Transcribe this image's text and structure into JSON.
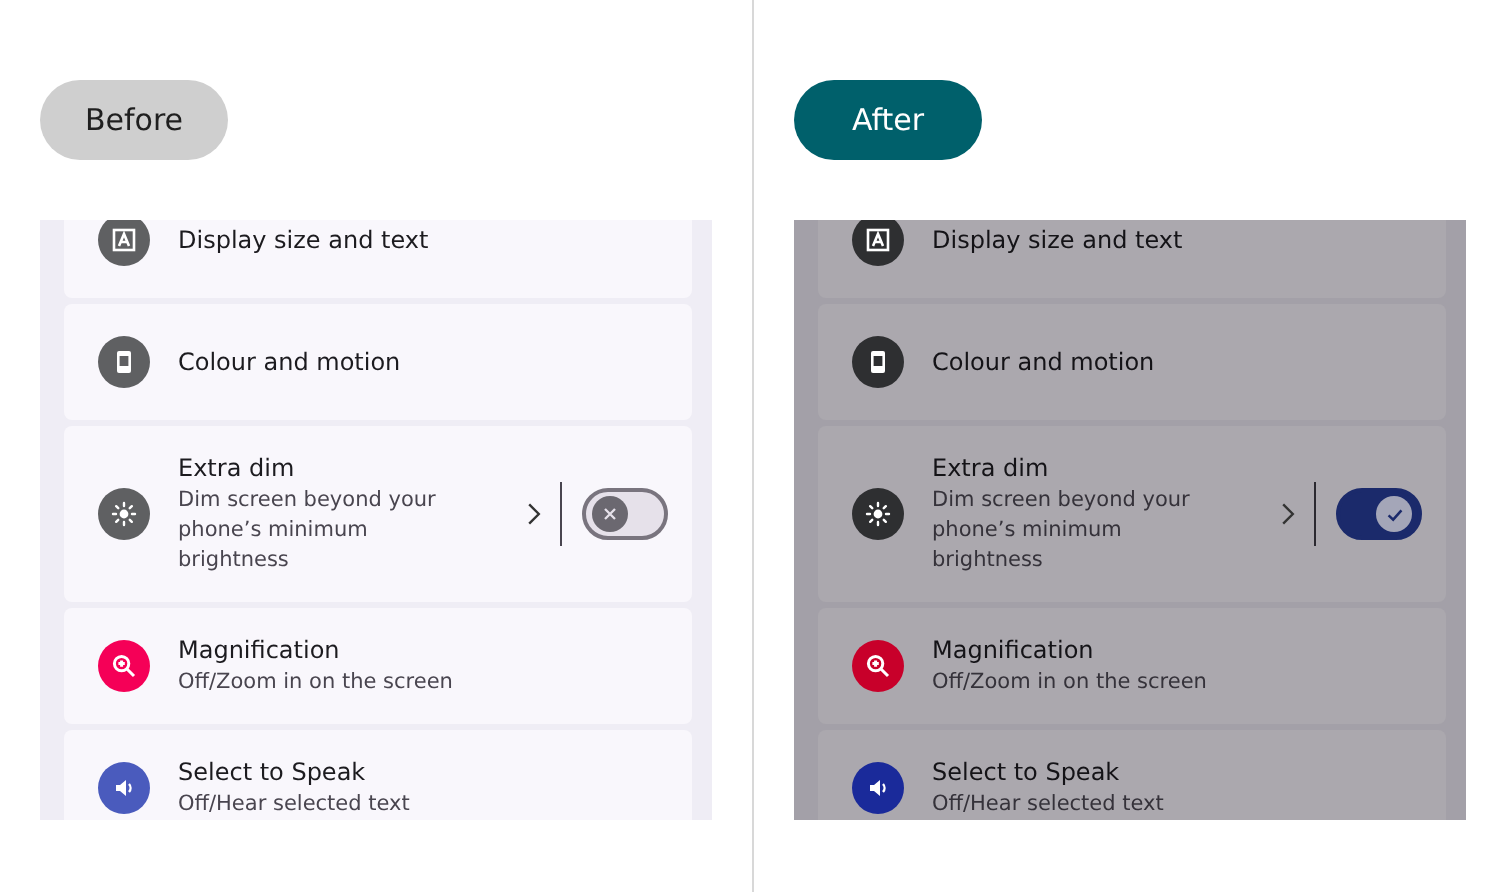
{
  "panels": [
    {
      "label": "Before",
      "color": "#cfcfcf",
      "dimmed": false,
      "items": [
        {
          "kind": "text",
          "color": "#5f6062",
          "title": "Display size and text"
        },
        {
          "kind": "phone",
          "color": "#5f6062",
          "title": "Colour and motion"
        },
        {
          "kind": "dim",
          "color": "#5f6062",
          "title": "Extra dim",
          "subtitle": "Dim screen beyond your phone’s minimum brightness",
          "toggle": {
            "on": false
          }
        },
        {
          "kind": "magnify",
          "color": "#f50057",
          "title": "Magnification",
          "subtitle": "Off/Zoom in on the screen"
        },
        {
          "kind": "speaker",
          "color": "#4a5bbd",
          "title": "Select to Speak",
          "subtitle": "Off/Hear selected text"
        }
      ]
    },
    {
      "label": "After",
      "color": "#00606b",
      "dimmed": true,
      "items": [
        {
          "kind": "text",
          "color": "#2e2f31",
          "title": "Display size and text"
        },
        {
          "kind": "phone",
          "color": "#2e2f31",
          "title": "Colour and motion"
        },
        {
          "kind": "dim",
          "color": "#2e2f31",
          "title": "Extra dim",
          "subtitle": "Dim screen beyond your phone’s minimum brightness",
          "toggle": {
            "on": true
          }
        },
        {
          "kind": "magnify",
          "color": "#c8002a",
          "title": "Magnification",
          "subtitle": "Off/Zoom in on the screen"
        },
        {
          "kind": "speaker",
          "color": "#1a2a9a",
          "title": "Select to Speak",
          "subtitle": "Off/Hear selected text"
        }
      ]
    }
  ]
}
